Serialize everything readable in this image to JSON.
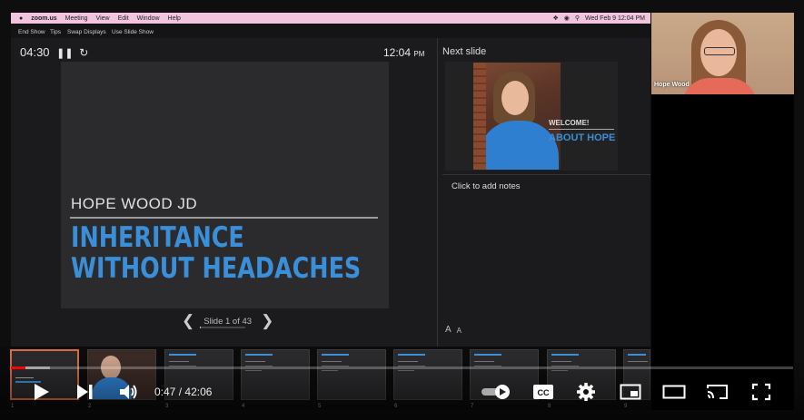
{
  "menubar": {
    "app": "zoom.us",
    "items": [
      "Meeting",
      "View",
      "Edit",
      "Window",
      "Help"
    ],
    "datetime": "Wed Feb 9  12:04 PM"
  },
  "toolbar": {
    "items": [
      "End Show",
      "Tips",
      "Swap Displays",
      "Use Slide Show"
    ]
  },
  "presenter": {
    "timer": "04:30",
    "clock": "12:04",
    "clock_ampm": "PM",
    "current_slide": {
      "name": "HOPE WOOD JD",
      "title": "INHERITANCE WITHOUT HEADACHES"
    },
    "slide_counter": "Slide 1 of 43",
    "slide_progress": 0.023,
    "next_slide_label": "Next slide",
    "next_slide": {
      "line1": "WELCOME!",
      "line2": "ABOUT HOPE"
    },
    "notes_placeholder": "Click to add notes",
    "font_buttons": [
      "A",
      "A"
    ]
  },
  "filmstrip": {
    "numbers": [
      "1",
      "2",
      "3",
      "4",
      "5",
      "6",
      "7",
      "8",
      "9"
    ]
  },
  "webcam": {
    "participant": "Hope Wood"
  },
  "player": {
    "time_current": "0:47",
    "time_separator": "/",
    "time_total": "42:06",
    "progress_fraction": 0.0186,
    "buffer_fraction": 0.05,
    "accent": "#ff0000"
  }
}
